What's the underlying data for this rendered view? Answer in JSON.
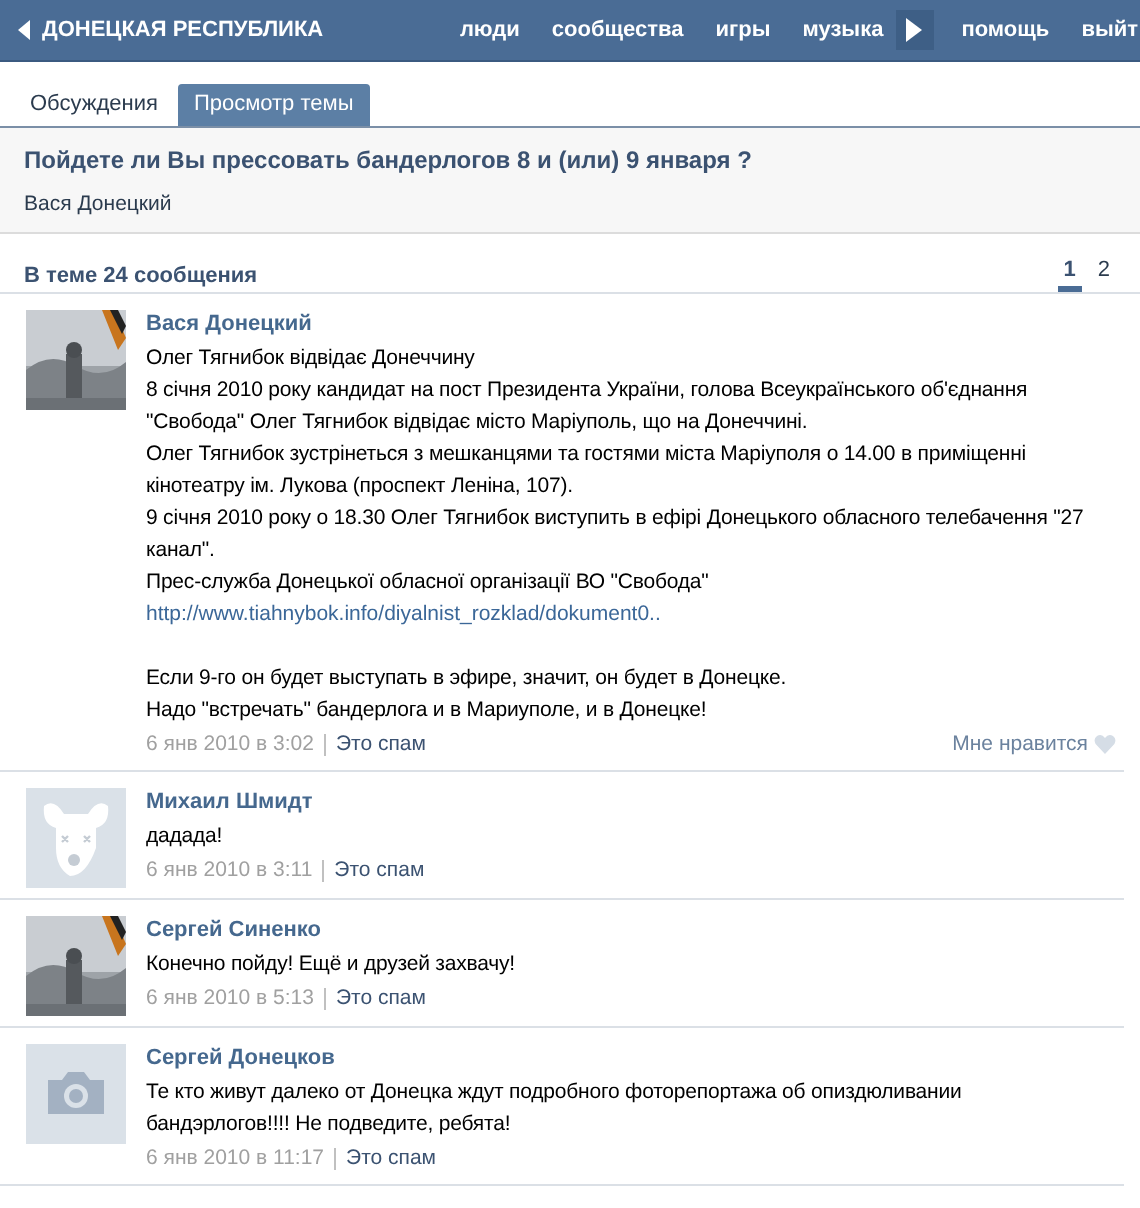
{
  "header": {
    "title": "ДОНЕЦКАЯ РЕСПУБЛИКА",
    "nav": [
      {
        "kind": "link",
        "label": "люди"
      },
      {
        "kind": "link",
        "label": "сообщества"
      },
      {
        "kind": "link",
        "label": "игры"
      },
      {
        "kind": "link",
        "label": "музыка"
      },
      {
        "kind": "arrow"
      },
      {
        "kind": "link",
        "label": "помощь"
      },
      {
        "kind": "link",
        "label": "выйт"
      }
    ]
  },
  "tabs": [
    {
      "label": "Обсуждения",
      "selected": false
    },
    {
      "label": "Просмотр темы",
      "selected": true
    }
  ],
  "topic": {
    "title": "Пойдете ли Вы прессовать бандерлогов 8 и (или) 9 января ?",
    "author": "Вася Донецкий"
  },
  "summary": "В теме 24 сообщения",
  "pages": [
    {
      "label": "1",
      "selected": true
    },
    {
      "label": "2",
      "selected": false
    }
  ],
  "posts": [
    {
      "author": "Вася Донецкий",
      "avatar": {
        "kind": "picture"
      },
      "date": "6 янв 2010 в 3:02",
      "spam": "Это спам",
      "like": "Мне нравится",
      "paragraphs": [
        {
          "kind": "text",
          "text": "Олег Тягнибок відвідає Донеччину"
        },
        {
          "kind": "text",
          "text": "8 січня 2010 року кандидат на пост Президента України, голова Всеукраїнського об'єднання \"Свобода\" Олег Тягнибок відвідає місто Маріуполь, що на Донеччині."
        },
        {
          "kind": "text",
          "text": "Олег Тягнибок зустрінеться з мешканцями та гостями міста Маріуполя о 14.00 в приміщенні кінотеатру ім. Лукова (проспект Леніна, 107)."
        },
        {
          "kind": "text",
          "text": "9 січня 2010 року о 18.30 Олег Тягнибок виступить в ефірі Донецького обласного телебачення \"27 канал\"."
        },
        {
          "kind": "text",
          "text": "Прес-служба Донецької обласної організації ВО \"Свобода\""
        },
        {
          "kind": "link",
          "text": "http://www.tiahnybok.info/diyalnist_rozklad/dokument0.."
        },
        {
          "kind": "gap",
          "text": "Если 9-го он будет выступать в эфире, значит, он будет в Донецке."
        },
        {
          "kind": "text",
          "text": "Надо \"встречать\" бандерлога и в Мариуполе, и в Донецке!"
        }
      ]
    },
    {
      "author": "Михаил Шмидт",
      "avatar": {
        "kind": "dog"
      },
      "date": "6 янв 2010 в 3:11",
      "spam": "Это спам",
      "paragraphs": [
        {
          "kind": "text",
          "text": "дадада!"
        }
      ]
    },
    {
      "author": "Сергей Синенко",
      "avatar": {
        "kind": "picture"
      },
      "date": "6 янв 2010 в 5:13",
      "spam": "Это спам",
      "paragraphs": [
        {
          "kind": "text",
          "text": "Конечно пойду! Ещё и друзей захвачу!"
        }
      ]
    },
    {
      "author": "Сергей Донецков",
      "avatar": {
        "kind": "camera"
      },
      "date": "6 янв 2010 в 11:17",
      "spam": "Это спам",
      "paragraphs": [
        {
          "kind": "text",
          "text": "Те кто живут далеко от Донецка ждут подробного фоторепортажа об опиздюливании бандэрлогов!!!! Не подведите, ребята!"
        }
      ]
    }
  ]
}
